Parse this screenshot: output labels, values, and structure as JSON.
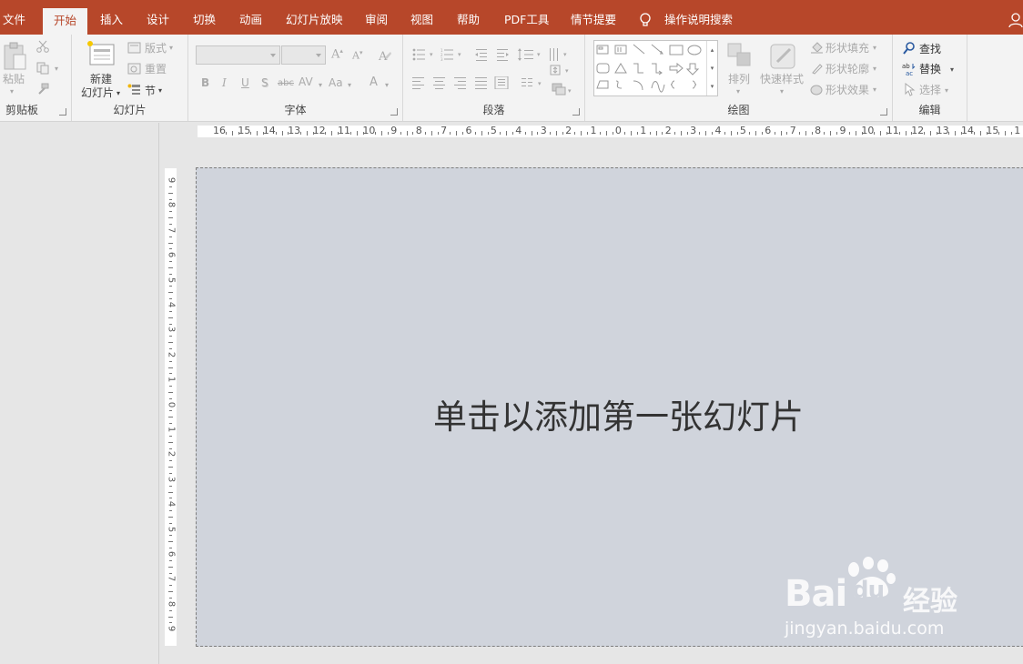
{
  "tabs": [
    {
      "label": "文件",
      "active": false
    },
    {
      "label": "开始",
      "active": true
    },
    {
      "label": "插入",
      "active": false
    },
    {
      "label": "设计",
      "active": false
    },
    {
      "label": "切换",
      "active": false
    },
    {
      "label": "动画",
      "active": false
    },
    {
      "label": "幻灯片放映",
      "active": false
    },
    {
      "label": "审阅",
      "active": false
    },
    {
      "label": "视图",
      "active": false
    },
    {
      "label": "帮助",
      "active": false
    },
    {
      "label": "PDF工具",
      "active": false
    },
    {
      "label": "情节提要",
      "active": false
    }
  ],
  "tell_me": "操作说明搜索",
  "ribbon": {
    "clipboard": {
      "label": "剪贴板",
      "paste": "粘贴"
    },
    "slides": {
      "label": "幻灯片",
      "new_slide_line1": "新建",
      "new_slide_line2": "幻灯片",
      "layout": "版式",
      "reset": "重置",
      "section": "节"
    },
    "font": {
      "label": "字体",
      "font_name": "",
      "font_size": "",
      "bold": "B",
      "italic": "I",
      "underline": "U",
      "shadow": "S",
      "strike": "abc",
      "spacing": "AV",
      "case": "Aa",
      "color": "A"
    },
    "paragraph": {
      "label": "段落"
    },
    "drawing": {
      "label": "绘图",
      "arrange": "排列",
      "quick_styles": "快速样式",
      "shape_fill": "形状填充",
      "shape_outline": "形状轮廓",
      "shape_effects": "形状效果"
    },
    "editing": {
      "label": "编辑",
      "find": "查找",
      "replace": "替换",
      "select": "选择"
    }
  },
  "rulers": {
    "horizontal": [
      "16",
      "15",
      "14",
      "13",
      "12",
      "11",
      "10",
      "9",
      "8",
      "7",
      "6",
      "5",
      "4",
      "3",
      "2",
      "1",
      "0",
      "1",
      "2",
      "3",
      "4",
      "5",
      "6",
      "7",
      "8",
      "9",
      "10",
      "11",
      "12",
      "13",
      "14",
      "15",
      "1"
    ],
    "vertical": [
      "9",
      "8",
      "7",
      "6",
      "5",
      "4",
      "3",
      "2",
      "1",
      "0",
      "1",
      "2",
      "3",
      "4",
      "5",
      "6",
      "7",
      "8",
      "9"
    ]
  },
  "slide": {
    "placeholder": "单击以添加第一张幻灯片"
  },
  "watermark": {
    "brand": "Bai",
    "brand_du": "du",
    "brand_cn": "经验",
    "url": "jingyan.baidu.com"
  },
  "colors": {
    "accent": "#b7472a",
    "slide_bg": "#d0d4dc",
    "ribbon_bg": "#f3f3f3"
  }
}
